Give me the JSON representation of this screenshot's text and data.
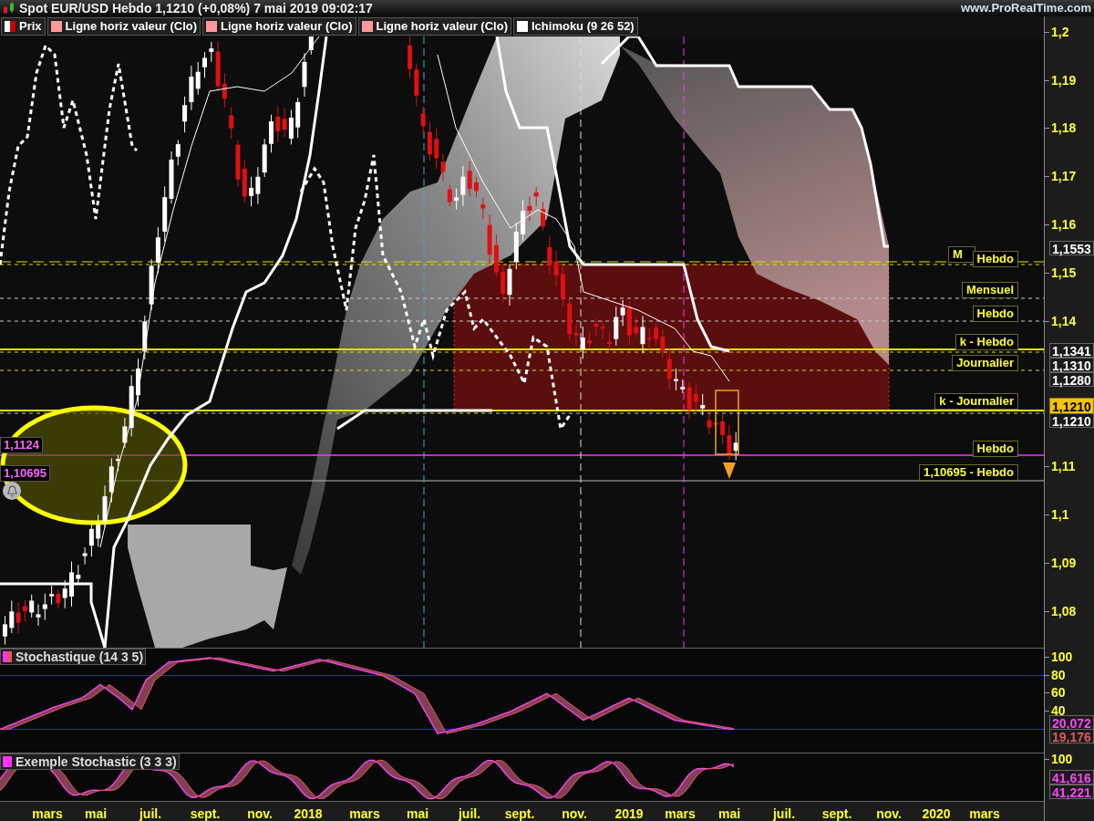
{
  "window": {
    "title": "Spot EUR/USD Hebdo 1,1210 (+0,08%) 7 mai 2019 09:02:17",
    "site": "www.ProRealTime.com"
  },
  "legend": [
    {
      "label": "Prix",
      "color": "#cc0000"
    },
    {
      "label": "Ligne horiz valeur (Clo)",
      "color": "#ff9999"
    },
    {
      "label": "Ligne horiz valeur (Clo)",
      "color": "#ff9999"
    },
    {
      "label": "Ligne horiz valeur (Clo)",
      "color": "#ff9999"
    },
    {
      "label": "Ichimoku (9 26 52)",
      "color": "#ffffff"
    }
  ],
  "price_chart": {
    "level_labels": [
      {
        "text": "M"
      },
      {
        "text": "Hebdo"
      },
      {
        "text": "Mensuel"
      },
      {
        "text": "Hebdo"
      },
      {
        "text": "k - Hebdo"
      },
      {
        "text": "Journalier"
      },
      {
        "text": "k - Journalier"
      },
      {
        "text": "Hebdo"
      },
      {
        "text": "1,10695 - Hebdo"
      }
    ],
    "alerts": [
      {
        "text": "1,1124"
      },
      {
        "text": "1,10695"
      }
    ],
    "axis": [
      {
        "kind": "tick",
        "text": "1,2"
      },
      {
        "kind": "tick",
        "text": "1,19"
      },
      {
        "kind": "tick",
        "text": "1,18"
      },
      {
        "kind": "tick",
        "text": "1,17"
      },
      {
        "kind": "tick",
        "text": "1,16"
      },
      {
        "kind": "box",
        "text": "1,1553"
      },
      {
        "kind": "tick",
        "text": "1,15"
      },
      {
        "kind": "tick",
        "text": "1,14"
      },
      {
        "kind": "box",
        "text": "1,1341"
      },
      {
        "kind": "box",
        "text": "1,1310"
      },
      {
        "kind": "box",
        "text": "1,1280"
      },
      {
        "kind": "current",
        "text": "1,1210"
      },
      {
        "kind": "box",
        "text": "1,1210"
      },
      {
        "kind": "tick",
        "text": "1,11"
      },
      {
        "kind": "tick",
        "text": "1,1"
      },
      {
        "kind": "tick",
        "text": "1,09"
      },
      {
        "kind": "tick",
        "text": "1,08"
      }
    ]
  },
  "stochastic": {
    "title": "Stochastique (14 3 5)",
    "axis": [
      {
        "kind": "tick",
        "text": "100"
      },
      {
        "kind": "tick",
        "text": "80"
      },
      {
        "kind": "tick",
        "text": "60"
      },
      {
        "kind": "tick",
        "text": "40"
      },
      {
        "kind": "box",
        "text": "20,072",
        "color": "#ff44ff"
      },
      {
        "kind": "box",
        "text": "19,176",
        "color": "#e05a5a"
      }
    ]
  },
  "example_stochastic": {
    "title": "Exemple Stochastic (3 3 3)",
    "axis": [
      {
        "kind": "tick",
        "text": "100"
      },
      {
        "kind": "box",
        "text": "41,616",
        "color": "#ff44ff"
      },
      {
        "kind": "box",
        "text": "41,221",
        "color": "#ff44ff"
      }
    ]
  },
  "time_axis": [
    "mars",
    "mai",
    "juil.",
    "sept.",
    "nov.",
    "2018",
    "mars",
    "mai",
    "juil.",
    "sept.",
    "nov.",
    "2019",
    "mars",
    "mai",
    "juil.",
    "sept.",
    "nov.",
    "2020",
    "mars"
  ]
}
